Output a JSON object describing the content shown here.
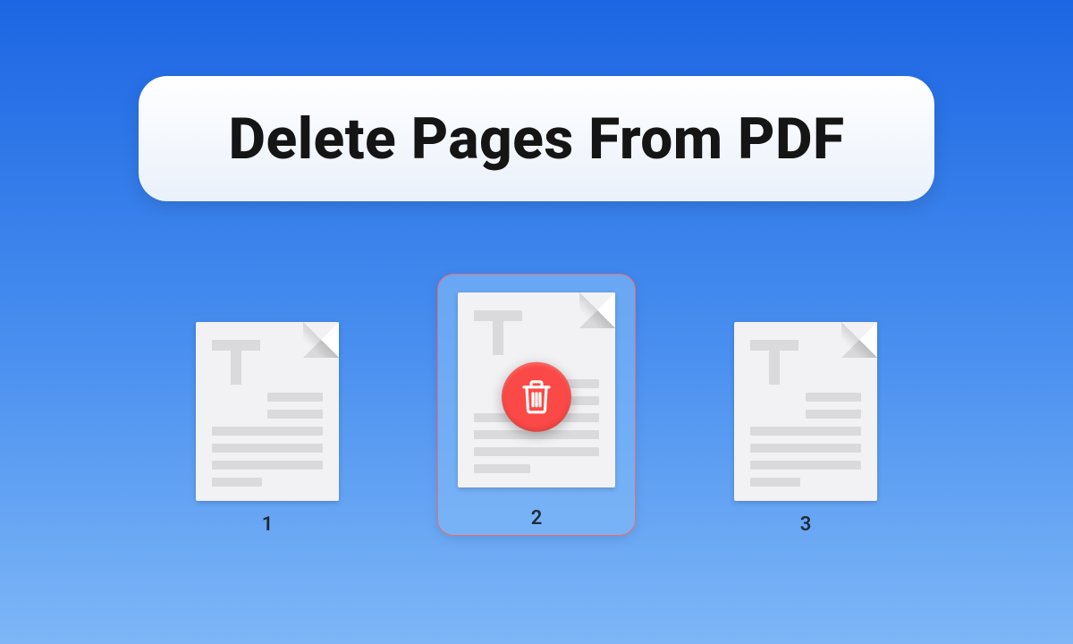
{
  "header": {
    "title": "Delete Pages From PDF"
  },
  "pages": [
    {
      "number": "1",
      "selected": false
    },
    {
      "number": "2",
      "selected": true
    },
    {
      "number": "3",
      "selected": false
    }
  ],
  "colors": {
    "delete": "#fa4946",
    "selection_border": "#ef6d6a"
  }
}
